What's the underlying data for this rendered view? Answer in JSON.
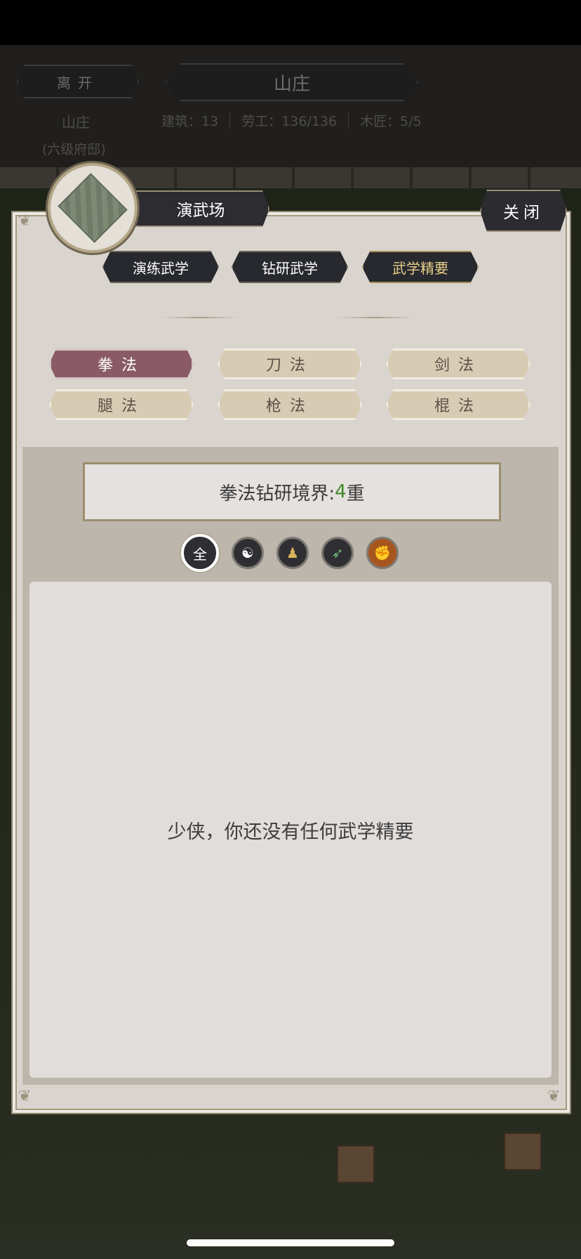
{
  "header": {
    "leave_label": "离开",
    "title": "山庄",
    "location_name": "山庄",
    "location_rank": "(六级府邸)",
    "stats": [
      {
        "label": "建筑：",
        "value": "13"
      },
      {
        "label": "劳工：",
        "value": "136/136"
      },
      {
        "label": "木匠：",
        "value": "5/5"
      }
    ]
  },
  "building": {
    "name": "演武场",
    "icon": "training-ground-icon"
  },
  "close_label": "关闭",
  "tabs": [
    {
      "label": "演练武学",
      "active": false
    },
    {
      "label": "钻研武学",
      "active": false
    },
    {
      "label": "武学精要",
      "active": true
    }
  ],
  "styles": [
    {
      "label": "拳法",
      "active": true
    },
    {
      "label": "刀法",
      "active": false
    },
    {
      "label": "剑法",
      "active": false
    },
    {
      "label": "腿法",
      "active": false
    },
    {
      "label": "枪法",
      "active": false
    },
    {
      "label": "棍法",
      "active": false
    }
  ],
  "realm": {
    "prefix": "拳法钻研境界:",
    "level": "4",
    "suffix": "重"
  },
  "filters": [
    {
      "icon": "all-icon",
      "glyph": "全",
      "active": true
    },
    {
      "icon": "yin-yang-icon",
      "glyph": "☯",
      "active": false
    },
    {
      "icon": "body-icon",
      "glyph": "♟",
      "active": false
    },
    {
      "icon": "boot-icon",
      "glyph": "➶",
      "active": false
    },
    {
      "icon": "fist-icon",
      "glyph": "✊",
      "active": false
    }
  ],
  "empty_message": "少侠，你还没有任何武学精要",
  "colors": {
    "panel": "#d9d4ce",
    "active_chip": "#8a5b66",
    "chip": "#d8cbb3",
    "tab_dark": "#27292e",
    "active_tab_text": "#e9cf8a",
    "realm_level": "#3f8a2a"
  }
}
